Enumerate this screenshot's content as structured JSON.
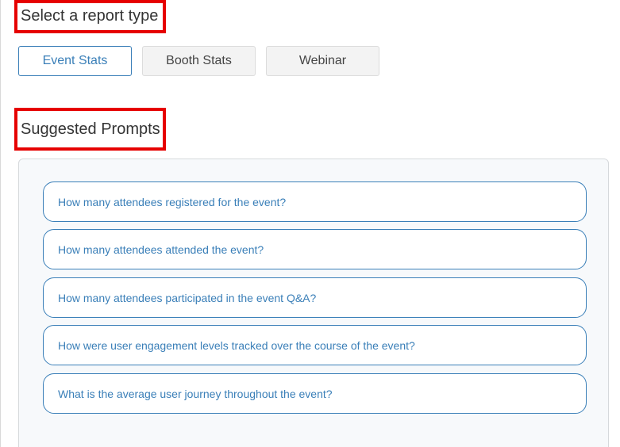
{
  "report_type": {
    "title": "Select a report type",
    "tabs": [
      {
        "label": "Event Stats",
        "active": true
      },
      {
        "label": "Booth Stats",
        "active": false
      },
      {
        "label": "Webinar",
        "active": false
      }
    ]
  },
  "suggested_prompts": {
    "title": "Suggested Prompts",
    "items": [
      {
        "label": "How many attendees registered for the event?"
      },
      {
        "label": "How many attendees attended the event?"
      },
      {
        "label": "How many attendees participated in the event Q&A?"
      },
      {
        "label": "How were user engagement levels tracked over the course of the event?"
      },
      {
        "label": "What is the average user journey throughout the event?"
      }
    ]
  },
  "colors": {
    "accent": "#3a7fb8",
    "highlight_border": "#e60000",
    "panel_background": "#f7f9fb"
  }
}
